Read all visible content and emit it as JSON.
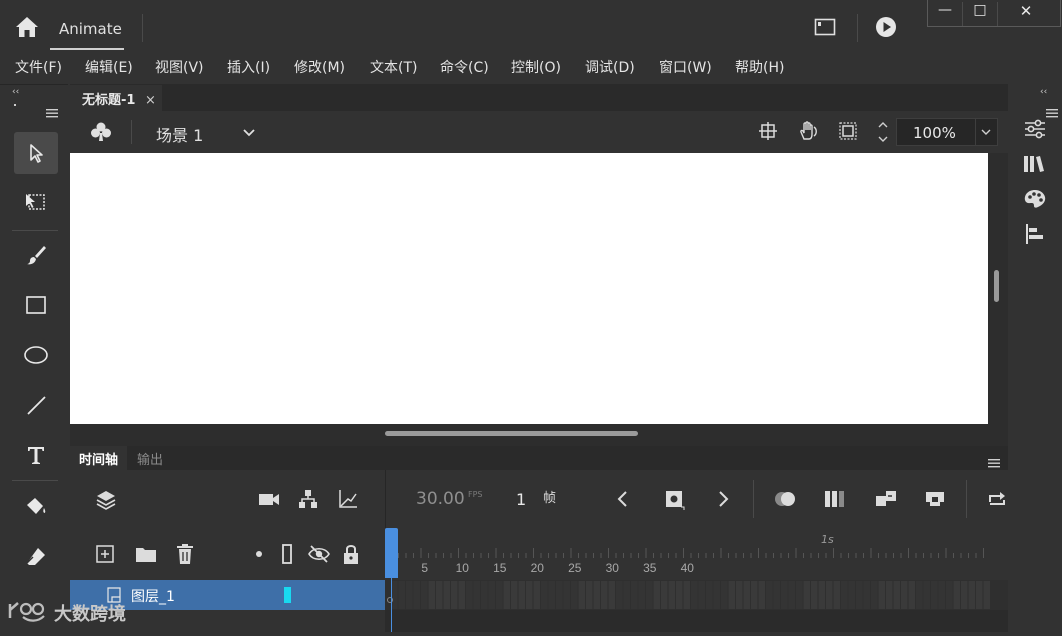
{
  "app": {
    "name": "Animate"
  },
  "window_controls": {
    "minimize": "—",
    "maximize": "□",
    "close": "✕"
  },
  "menu": [
    "文件(F)",
    "编辑(E)",
    "视图(V)",
    "插入(I)",
    "修改(M)",
    "文本(T)",
    "命令(C)",
    "控制(O)",
    "调试(D)",
    "窗口(W)",
    "帮助(H)"
  ],
  "document": {
    "tab_title": "无标题-1",
    "close_glyph": "×",
    "scene": "场景 1",
    "zoom": "100%"
  },
  "timeline": {
    "tabs": [
      "时间轴",
      "输出"
    ],
    "fps": "30.00",
    "fps_unit": "FPS",
    "current_frame": "1",
    "frame_unit": "帧",
    "ruler_seconds": "1s",
    "ruler_numbers": [
      "5",
      "10",
      "15",
      "20",
      "25",
      "30",
      "35",
      "40"
    ],
    "layer_name": "图层_1"
  },
  "watermark": "大数跨境",
  "colors": {
    "accent": "#3e6fa8",
    "playhead": "#4a8fe0",
    "layer_color_swatch": "#19d9f0",
    "stage": "#ffffff"
  }
}
